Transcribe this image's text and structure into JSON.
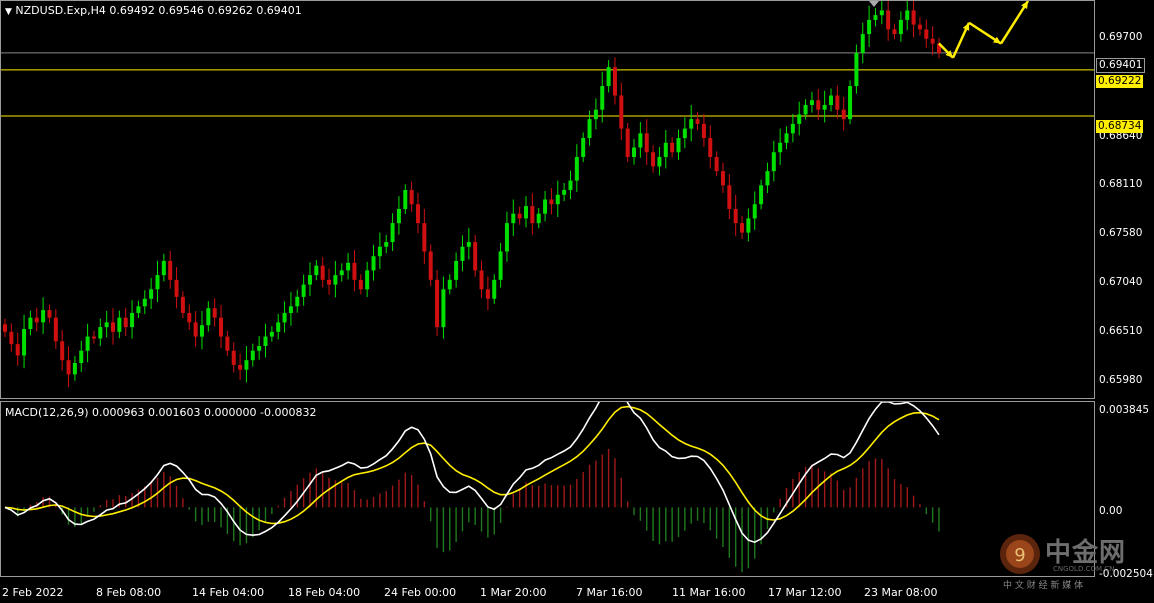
{
  "main": {
    "title_arrow": "▼",
    "title": "NZDUSD.Exp,H4  0.69492 0.69546 0.69262 0.69401",
    "price_ticks": [
      "0.69700",
      "0.67040",
      "0.69222",
      "0.68110",
      "0.67580",
      "0.67040",
      "0.66510",
      "0.65980",
      "0.68640"
    ],
    "tags": {
      "current": "0.69401",
      "line1": "0.69222",
      "line2": "0.68734"
    }
  },
  "macd": {
    "title": "MACD(12,26,9) 0.000963 0.001603 0.000000 -0.000832",
    "ticks": [
      "0.003845",
      "0.00",
      "-0.002504"
    ]
  },
  "x_labels": [
    "2 Feb 2022",
    "8 Feb 08:00",
    "14 Feb 04:00",
    "18 Feb 04:00",
    "24 Feb 00:00",
    "1 Mar 20:00",
    "7 Mar 16:00",
    "11 Mar 16:00",
    "17 Mar 12:00",
    "23 Mar 08:00"
  ],
  "watermark": {
    "logo_text": "中金网",
    "sub": "CNGOLD.COM.CN",
    "tagline": "中 文 财 经 新 媒 体"
  },
  "colors": {
    "up": "#00e000",
    "down": "#d01010",
    "hline": "#ffee00",
    "macd_line": "#ffffff",
    "signal_line": "#ffee00",
    "arrow": "#ffee00"
  },
  "chart_data": {
    "type": "candlestick",
    "symbol": "NZDUSD.Exp",
    "timeframe": "H4",
    "ohlc_current": {
      "open": 0.69492,
      "high": 0.69546,
      "low": 0.69262,
      "close": 0.69401
    },
    "price_axis": {
      "min": 0.6575,
      "max": 0.6995
    },
    "horizontal_levels": [
      0.69401,
      0.69222,
      0.68734
    ],
    "closes": [
      0.6645,
      0.6632,
      0.662,
      0.6648,
      0.666,
      0.6655,
      0.6668,
      0.666,
      0.6635,
      0.6615,
      0.66,
      0.6612,
      0.6625,
      0.664,
      0.6638,
      0.665,
      0.6655,
      0.6645,
      0.666,
      0.665,
      0.6665,
      0.6672,
      0.668,
      0.669,
      0.6705,
      0.672,
      0.67,
      0.6682,
      0.6665,
      0.6655,
      0.664,
      0.6652,
      0.667,
      0.666,
      0.664,
      0.6625,
      0.661,
      0.6605,
      0.6615,
      0.6625,
      0.663,
      0.664,
      0.6645,
      0.6655,
      0.6665,
      0.6672,
      0.6682,
      0.6695,
      0.6705,
      0.6715,
      0.67,
      0.6695,
      0.6705,
      0.671,
      0.6718,
      0.67,
      0.669,
      0.671,
      0.6725,
      0.6735,
      0.674,
      0.676,
      0.6775,
      0.6795,
      0.678,
      0.676,
      0.673,
      0.67,
      0.665,
      0.669,
      0.67,
      0.672,
      0.6735,
      0.674,
      0.671,
      0.669,
      0.668,
      0.67,
      0.673,
      0.676,
      0.677,
      0.6765,
      0.6778,
      0.676,
      0.677,
      0.6785,
      0.678,
      0.679,
      0.6795,
      0.6805,
      0.683,
      0.685,
      0.687,
      0.688,
      0.6905,
      0.6925,
      0.6895,
      0.686,
      0.683,
      0.684,
      0.6855,
      0.6835,
      0.682,
      0.683,
      0.6845,
      0.6835,
      0.685,
      0.686,
      0.687,
      0.6865,
      0.685,
      0.683,
      0.6815,
      0.68,
      0.6775,
      0.676,
      0.675,
      0.6765,
      0.678,
      0.68,
      0.6815,
      0.6835,
      0.6845,
      0.6855,
      0.6865,
      0.6875,
      0.6885,
      0.689,
      0.688,
      0.6885,
      0.6895,
      0.688,
      0.687,
      0.6905,
      0.694,
      0.696,
      0.6975,
      0.698,
      0.6985,
      0.6965,
      0.696,
      0.6975,
      0.6985,
      0.697,
      0.6965,
      0.6955,
      0.695,
      0.694
    ],
    "macd": {
      "min": -0.002504,
      "max": 0.003845
    },
    "projection_arrows": [
      [
        0.695,
        0.6935
      ],
      [
        0.6935,
        0.6972
      ],
      [
        0.6972,
        0.695
      ],
      [
        0.695,
        0.6995
      ]
    ]
  }
}
